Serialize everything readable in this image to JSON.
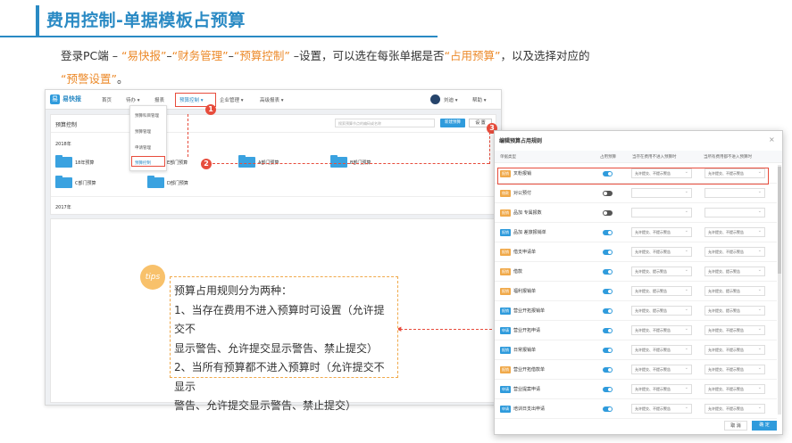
{
  "slide": {
    "title": "费用控制-单据模板占预算",
    "desc_parts": [
      "登录PC端 – ",
      "“易快报”",
      "–",
      "“财务管理”",
      "–",
      "“预算控制”",
      " –设置，可以选在每张单据是否",
      "“占用预算”",
      "，以及选择对应的"
    ],
    "desc2_parts": [
      "“预警设置”",
      "。"
    ]
  },
  "app": {
    "brand": "易快报",
    "nav": [
      "首页",
      "待办 ▾",
      "报表",
      "预算控制 ▾",
      "企业管理 ▾",
      "高级报表 ▾"
    ],
    "user": "刘迪 ▾",
    "help": "帮助 ▾",
    "panel_title": "预算控制",
    "search_placeholder": "搜索预算节点的编码或名称",
    "new_btn": "新建预算",
    "settings_btn": "设 置",
    "year1": "2018年",
    "year2": "2017年",
    "folders": [
      "18年预算",
      "E部门预算",
      "A部门预算",
      "B部门预算",
      "C部门预算",
      "D部门预算"
    ],
    "dropdown": [
      "预算科目管理",
      "预算管理",
      "申请管理",
      "预算控制"
    ]
  },
  "callouts": [
    "1",
    "2",
    "3",
    "4"
  ],
  "tips": {
    "badge": "tips",
    "lines": [
      "预算占用规则分为两种：",
      "1、当存在费用不进入预算时可设置（允许提交不",
      "显示警告、允许提交显示警告、禁止提交）",
      "2、当所有预算都不进入预算时（允许提交不显示",
      "警告、允许提交显示警告、禁止提交）"
    ]
  },
  "modal": {
    "title": "编辑预算占用规则",
    "close": "×",
    "headers": [
      "单据类型",
      "占用预算",
      "当存在费用不进入预算时",
      "当所有费用都不进入预算时"
    ],
    "rows": [
      {
        "tag": "报销",
        "tag_color": "#f0a94a",
        "name": "叉粉报销",
        "on": true,
        "a": "允许提交、不提示警告",
        "b": "允许提交、不提示警告"
      },
      {
        "tag": "借款",
        "tag_color": "#f0a94a",
        "name": "对公预付",
        "on": false,
        "a": "",
        "b": ""
      },
      {
        "tag": "报销",
        "tag_color": "#f0a94a",
        "name": "品加 专属报数",
        "on": false,
        "a": "",
        "b": ""
      },
      {
        "tag": "报销",
        "tag_color": "#2f9bdc",
        "name": "品加 差旅报销单",
        "on": true,
        "a": "允许提交、不提示警告",
        "b": "允许提交、不提示警告"
      },
      {
        "tag": "报销",
        "tag_color": "#f0a94a",
        "name": "借支申请单",
        "on": true,
        "a": "允许提交、不提示警告",
        "b": "允许提交、不提示警告"
      },
      {
        "tag": "报销",
        "tag_color": "#f0a94a",
        "name": "借款",
        "on": true,
        "a": "允许提交、提示警告",
        "b": "允许提交、提示警告"
      },
      {
        "tag": "报销",
        "tag_color": "#f0a94a",
        "name": "福利报销单",
        "on": true,
        "a": "允许提交、提示警告",
        "b": "允许提交、提示警告"
      },
      {
        "tag": "报销",
        "tag_color": "#2f9bdc",
        "name": "营业开拓报销单",
        "on": true,
        "a": "允许提交、提示警告",
        "b": "允许提交、提示警告"
      },
      {
        "tag": "申请",
        "tag_color": "#2f9bdc",
        "name": "营业开拓申请",
        "on": true,
        "a": "允许提交、不提示警告",
        "b": "允许提交、不提示警告"
      },
      {
        "tag": "报销",
        "tag_color": "#2f9bdc",
        "name": "日常报销单",
        "on": true,
        "a": "允许提交、不提示警告",
        "b": "允许提交、不提示警告"
      },
      {
        "tag": "报销",
        "tag_color": "#f0a94a",
        "name": "营业开拓借款单",
        "on": true,
        "a": "允许提交、不提示警告",
        "b": "允许提交、不提示警告"
      },
      {
        "tag": "申请",
        "tag_color": "#2f9bdc",
        "name": "营业提案申请",
        "on": true,
        "a": "允许提交、不提示警告",
        "b": "允许提交、不提示警告"
      },
      {
        "tag": "申请",
        "tag_color": "#2f9bdc",
        "name": "培训日支出申请",
        "on": true,
        "a": "允许提交、不提示警告",
        "b": "允许提交、不提示警告"
      }
    ],
    "cancel": "取 消",
    "ok": "确 定"
  }
}
